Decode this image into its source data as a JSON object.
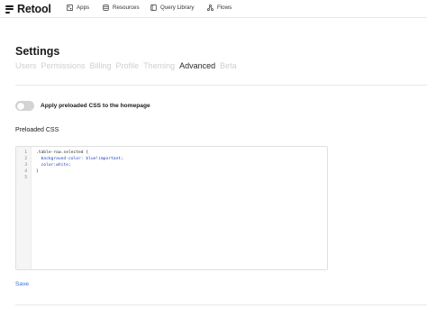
{
  "brand": {
    "name": "Retool"
  },
  "nav": [
    {
      "label": "Apps",
      "icon": "apps-icon"
    },
    {
      "label": "Resources",
      "icon": "database-icon"
    },
    {
      "label": "Query Library",
      "icon": "book-icon"
    },
    {
      "label": "Flows",
      "icon": "flows-icon"
    }
  ],
  "settings": {
    "title": "Settings",
    "tabs": [
      "Users",
      "Permissions",
      "Billing",
      "Profile",
      "Theming",
      "Advanced",
      "Beta"
    ],
    "active_tab": "Advanced"
  },
  "toggle": {
    "label": "Apply preloaded CSS to the homepage",
    "checked": false
  },
  "css_section": {
    "label": "Preloaded CSS"
  },
  "editor": {
    "line_numbers": [
      "1",
      "2",
      "3",
      "4",
      "5"
    ],
    "lines": [
      ".table-row.selected {",
      "  background-color: blue!important;",
      "  color:white;",
      "}",
      ""
    ]
  },
  "actions": {
    "save_label": "Save"
  },
  "colors": {
    "accent": "#3a6fd8",
    "code_keyword": "#1f3fbf",
    "toggle_off": "#d4d4d4"
  }
}
